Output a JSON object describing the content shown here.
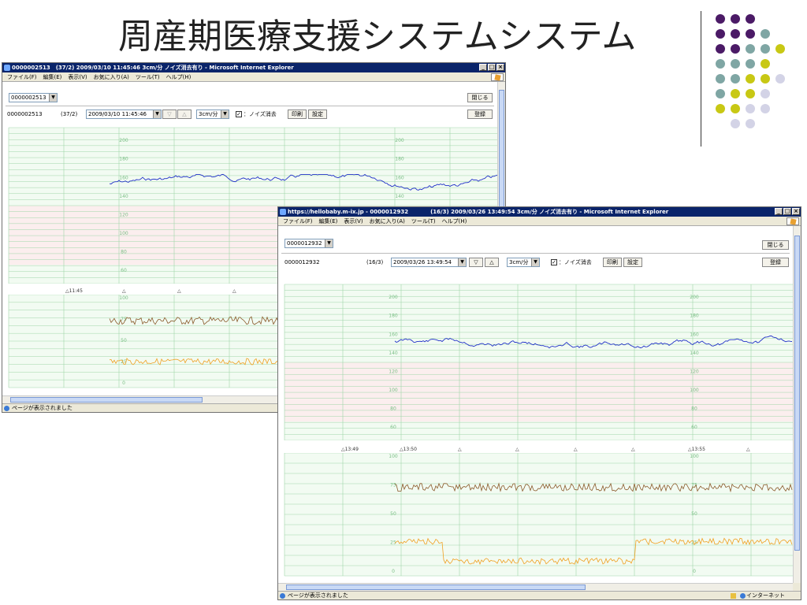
{
  "slide": {
    "title": "周産期医療支援システムシステム",
    "dot_colors": {
      "purple": "#4b1a66",
      "teal": "#7fa6a4",
      "olive": "#c8c814",
      "lavender": "#d3d3e6"
    }
  },
  "colors": {
    "chart_grid": "#9fd6a8",
    "chart_bg": "#f2fbf2",
    "chart_band": "#fbeeee",
    "fhr_line": "#2030c8",
    "toco_brown": "#8a5a2a",
    "toco_orange": "#f0a020",
    "titlebar": "#0a246a"
  },
  "window1": {
    "title": "0000002513　(37/2) 2009/03/10 11:45:46 3cm/分 ノイズ消去有り - Microsoft Internet Explorer",
    "menu": [
      "ファイル(F)",
      "編集(E)",
      "表示(V)",
      "お気に入り(A)",
      "ツール(T)",
      "ヘルプ(H)"
    ],
    "patient_select": "0000002513",
    "close_label": "閉じる",
    "patient_id": "0000002513",
    "week": "(37/2)",
    "datetime": "2009/03/10 11:45:46",
    "down_symbol": "▽",
    "up_symbol": "△",
    "speed": "3cm/分",
    "noise_label": "：ノイズ消去",
    "print_label": "印刷",
    "settings_label": "設定",
    "register_label": "登録",
    "status": "ページが表示されました",
    "fhr_scale": [
      "200",
      "180",
      "160",
      "140",
      "120",
      "100",
      "80",
      "60"
    ],
    "toco_scale": [
      "100",
      "75",
      "50",
      "25",
      "0"
    ],
    "time_marker": "11:45"
  },
  "window2": {
    "title": "https://hellobaby.m-ix.jp - 0000012932　　　　(16/3) 2009/03/26 13:49:54 3cm/分 ノイズ消去有り - Microsoft Internet Explorer",
    "menu": [
      "ファイル(F)",
      "編集(E)",
      "表示(V)",
      "お気に入り(A)",
      "ツール(T)",
      "ヘルプ(H)"
    ],
    "patient_select": "0000012932",
    "close_label": "閉じる",
    "patient_id": "0000012932",
    "week": "(16/3)",
    "datetime": "2009/03/26 13:49:54",
    "down_symbol": "▽",
    "up_symbol": "△",
    "speed": "3cm/分",
    "noise_label": "：ノイズ消去",
    "print_label": "印刷",
    "settings_label": "設定",
    "register_label": "登録",
    "status": "ページが表示されました",
    "zone": "インターネット",
    "fhr_scale": [
      "200",
      "180",
      "160",
      "140",
      "120",
      "100",
      "80",
      "60"
    ],
    "toco_scale": [
      "100",
      "75",
      "50",
      "25",
      "0"
    ],
    "time_markers": [
      "13:49",
      "13:50",
      "13:55"
    ]
  }
}
